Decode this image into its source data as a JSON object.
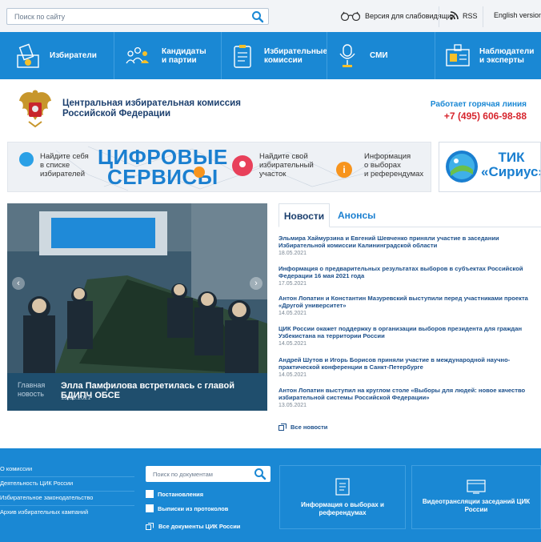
{
  "topbar": {
    "search_placeholder": "Поиск по сайту",
    "accessibility_label": "Версия для слабовидящих",
    "rss_label": "RSS",
    "english_label": "English version"
  },
  "nav": {
    "items": [
      {
        "label": "Избиратели",
        "icon": "ballot-box-icon"
      },
      {
        "label": "Кандидаты и партии",
        "icon": "people-group-icon"
      },
      {
        "label": "Избирательные комиссии",
        "icon": "clipboard-list-icon"
      },
      {
        "label": "СМИ",
        "icon": "microphone-icon"
      },
      {
        "label": "Наблюдатели и эксперты",
        "icon": "id-badge-icon"
      }
    ]
  },
  "header": {
    "org_line1": "Центральная избирательная комиссия",
    "org_line2": "Российской Федерации",
    "hotline_label": "Работает горячая линия",
    "hotline_phone": "+7 (495) 606-98-88"
  },
  "banner": {
    "find_self_line1": "Найдите себя",
    "find_self_line2": "в списке",
    "find_self_line3": "избирателей",
    "digital_line1": "ЦИФРОВЫЕ",
    "digital_line2": "СЕРВИСЫ",
    "find_station_line1": "Найдите свой",
    "find_station_line2": "избирательный",
    "find_station_line3": "участок",
    "info_line1": "Информация",
    "info_line2": "о выборах",
    "info_line3": "и референдумах",
    "tik_line1": "ТИК",
    "tik_line2": "«Сириус»"
  },
  "hero": {
    "label_line1": "Главная",
    "label_line2": "новость",
    "title": "Элла Памфилова встретилась с главой БДИПЧ ОБСЕ",
    "date": "13.05.2021"
  },
  "tabs": {
    "news": "Новости",
    "announcements": "Анонсы"
  },
  "news": [
    {
      "title": "Эльмира Хаймурзина и Евгений Шевченко приняли участие в заседании Избирательной комиссии Калининградской области",
      "date": "18.05.2021"
    },
    {
      "title": "Информация о предварительных результатах выборов в субъектах Российской Федерации 16 мая 2021 года",
      "date": "17.05.2021"
    },
    {
      "title": "Антон Лопатин и Константин Мазуревский выступили перед участниками проекта «Другой университет»",
      "date": "14.05.2021"
    },
    {
      "title": "ЦИК России окажет поддержку в организации выборов президента для граждан Узбекистана на территории России",
      "date": "14.05.2021"
    },
    {
      "title": "Андрей Шутов и Игорь Борисов приняли участие в международной научно-практической конференции в Санкт-Петербурге",
      "date": "14.05.2021"
    },
    {
      "title": "Антон Лопатин выступил на круглом столе «Выборы для людей: новое качество избирательной системы Российской Федерации»",
      "date": "13.05.2021"
    }
  ],
  "all_news": "Все новости",
  "footer": {
    "links": [
      "О комиссии",
      "Деятельность ЦИК России",
      "Избирательное законодательство",
      "Архив избирательных кампаний"
    ],
    "doc_search_placeholder": "Поиск по документам",
    "checkbox_decrees": "Постановления",
    "checkbox_minutes": "Выписки из протоколов",
    "all_docs": "Все документы ЦИК России",
    "card_info": "Информация о выборах и референдумах",
    "card_video": "Видеотрансляции заседаний ЦИК России"
  },
  "colors": {
    "brand_blue": "#1a88d4",
    "dark_navy": "#1b3f6e",
    "hotline_red": "#d7262e"
  }
}
